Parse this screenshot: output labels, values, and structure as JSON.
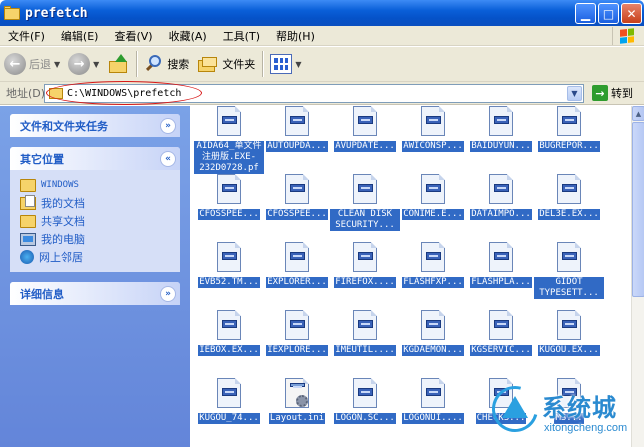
{
  "window": {
    "title": "prefetch"
  },
  "menu": [
    "文件(F)",
    "编辑(E)",
    "查看(V)",
    "收藏(A)",
    "工具(T)",
    "帮助(H)"
  ],
  "toolbar": {
    "back": "后退",
    "search": "搜索",
    "folders": "文件夹"
  },
  "address": {
    "label": "地址(D)",
    "value": "C:\\WINDOWS\\prefetch",
    "go": "转到"
  },
  "tasks": {
    "file_tasks_title": "文件和文件夹任务",
    "other_places_title": "其它位置",
    "places": [
      "WINDOWS",
      "我的文档",
      "共享文档",
      "我的电脑",
      "网上邻居"
    ],
    "details_title": "详细信息"
  },
  "files": [
    "AIDA64_单文件注册版.EXE-232D0728.pf",
    "AUTOUPDA...",
    "AVUPDATE...",
    "AWICONSP...",
    "BAIDUYUN...",
    "BUGREPOR...",
    "CFOSSPEE...",
    "CFOSSPEE...",
    "CLEAN DISK SECURITY...",
    "CONIME.E...",
    "DATAIMPO...",
    "DEL3E.EX...",
    "EVB52.TM...",
    "EXPLORER...",
    "FIREFOX....",
    "FLASHFXP...",
    "FLASHPLA...",
    "GIDOT TYPESETT...",
    "IEBOX.EX...",
    "IEXPLORE...",
    "IMEUTIL....",
    "KGDAEMON...",
    "KGSERVIC...",
    "KUGOU.EX...",
    "KUGOU_74...",
    "Layout.ini",
    "LOGON.SC...",
    "LOGONUI....",
    "CHECKS...",
    "MS..."
  ],
  "watermark": {
    "brand": "系统城",
    "url": "xitongcheng.com"
  }
}
